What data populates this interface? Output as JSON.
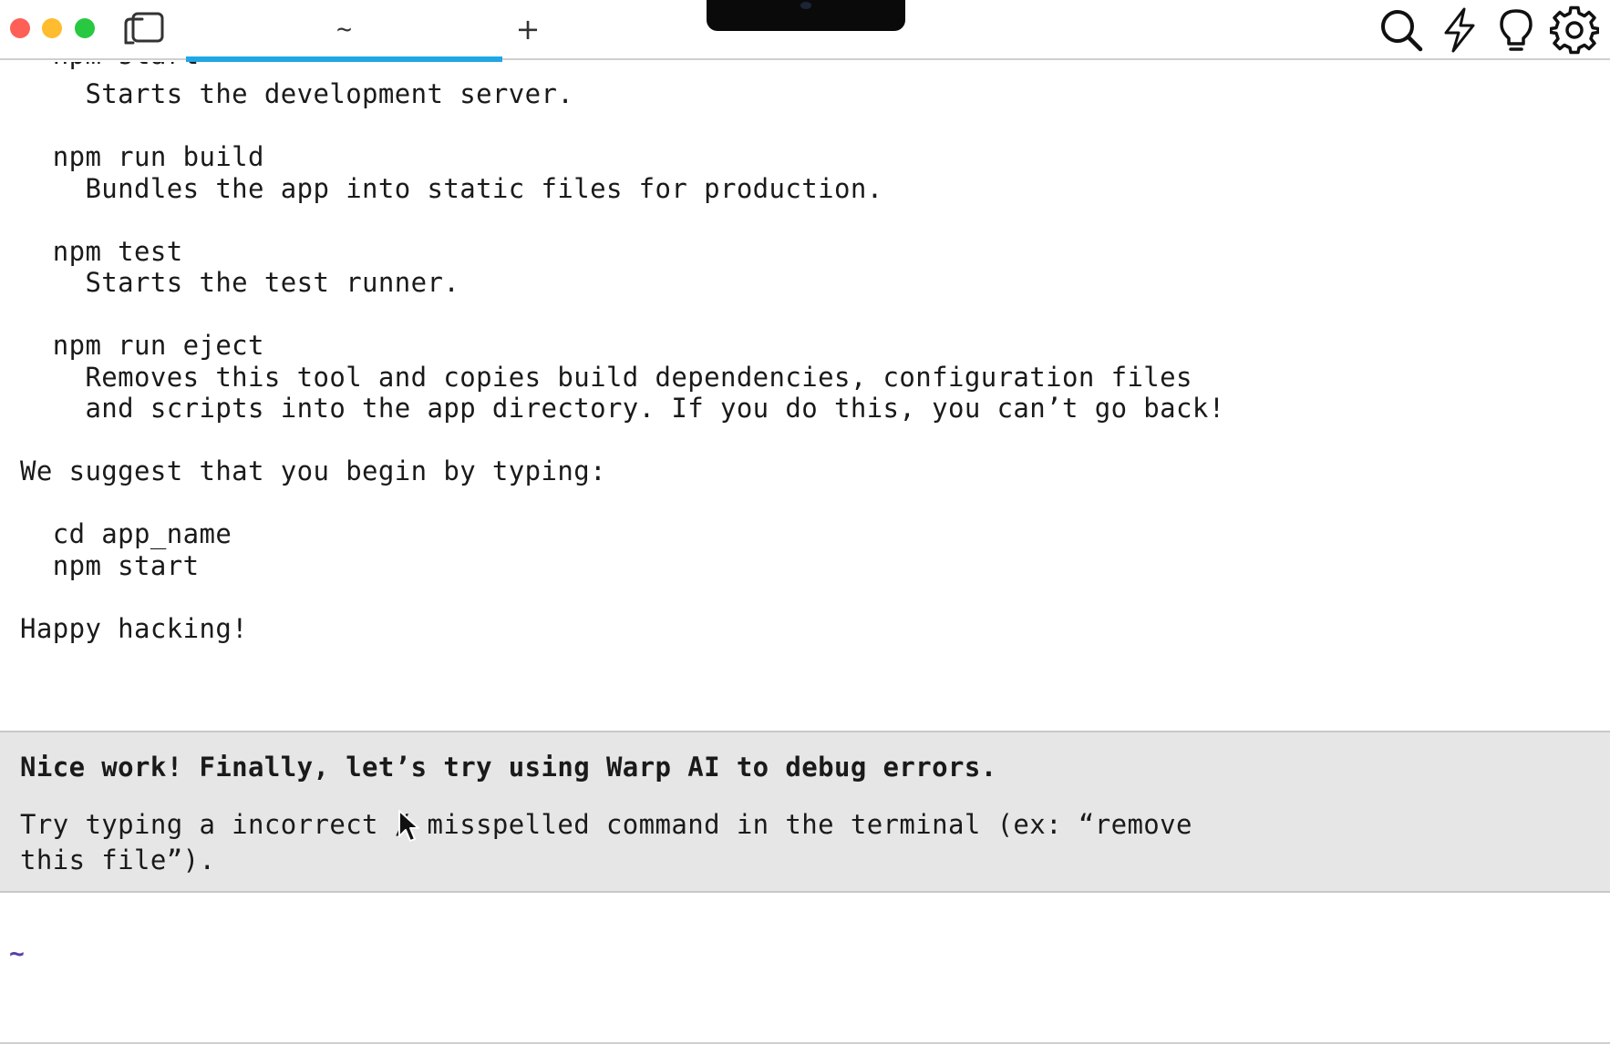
{
  "titlebar": {
    "tab_label": "~",
    "new_tab_label": "+"
  },
  "output": {
    "lines": [
      "  npm start",
      "    Starts the development server.",
      "",
      "  npm run build",
      "    Bundles the app into static files for production.",
      "",
      "  npm test",
      "    Starts the test runner.",
      "",
      "  npm run eject",
      "    Removes this tool and copies build dependencies, configuration files",
      "    and scripts into the app directory. If you do this, you can’t go back!",
      "",
      "We suggest that you begin by typing:",
      "",
      "  cd app_name",
      "  npm start",
      "",
      "Happy hacking!"
    ]
  },
  "hint": {
    "title": "Nice work! Finally, let’s try using Warp AI to debug errors.",
    "body": "Try typing a incorrect / misspelled command in the terminal (ex: “remove this file”)."
  },
  "prompt": {
    "directory": "~",
    "input_value": ""
  },
  "colors": {
    "tab_accent": "#1fa7e6",
    "prompt_dir": "#5b3fa8",
    "hint_background": "#e6e6e6"
  },
  "icons": [
    "split-panes-icon",
    "search-icon",
    "lightning-icon",
    "lightbulb-icon",
    "gear-icon"
  ]
}
